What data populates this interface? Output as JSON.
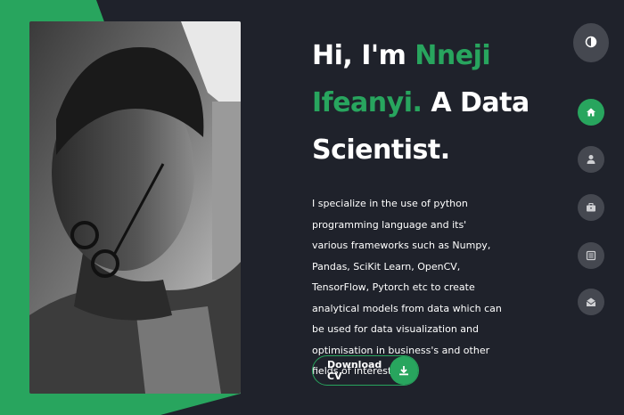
{
  "theme": {
    "background": "#1f222b",
    "accent": "#28a55e",
    "nav_button_color": "#454850",
    "text_color": "#ffffff"
  },
  "hero": {
    "greeting": "Hi, I'm ",
    "name": "Nneji Ifeanyi.",
    "role": " A Data Scientist.",
    "description": "I specialize in the use of python programming language and its' various frameworks such as Numpy, Pandas, SciKit Learn, OpenCV, TensorFlow, Pytorch etc to create analytical models from data which can be used for data visualization and optimisation in business's and other fields of interest."
  },
  "cta": {
    "label": "Download CV",
    "icon": "download-icon"
  },
  "theme_toggle": {
    "icon": "contrast-icon"
  },
  "nav": {
    "items": [
      {
        "name": "home",
        "icon": "home-icon",
        "active": true
      },
      {
        "name": "about",
        "icon": "user-icon",
        "active": false
      },
      {
        "name": "portfolio",
        "icon": "briefcase-icon",
        "active": false
      },
      {
        "name": "blog",
        "icon": "newspaper-icon",
        "active": false
      },
      {
        "name": "contact",
        "icon": "envelope-open-icon",
        "active": false
      }
    ]
  },
  "profile_photo": {
    "style": "black-and-white portrait"
  }
}
